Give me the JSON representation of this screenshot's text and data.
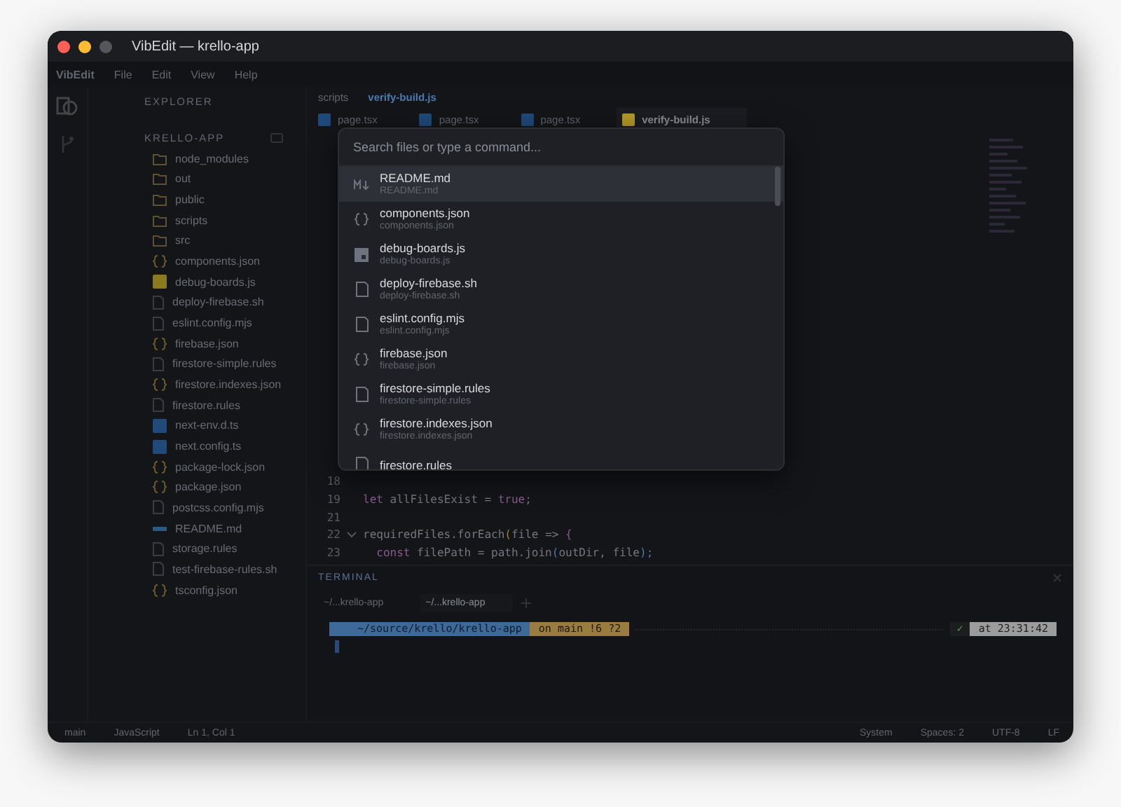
{
  "window": {
    "title": "VibEdit — krello-app"
  },
  "menu": [
    "VibEdit",
    "File",
    "Edit",
    "View",
    "Help"
  ],
  "sidebar": {
    "title": "EXPLORER",
    "project": "KRELLO-APP",
    "items": [
      {
        "label": "node_modules",
        "kind": "folder"
      },
      {
        "label": "out",
        "kind": "folder"
      },
      {
        "label": "public",
        "kind": "folder"
      },
      {
        "label": "scripts",
        "kind": "folder"
      },
      {
        "label": "src",
        "kind": "folder"
      },
      {
        "label": "components.json",
        "kind": "json"
      },
      {
        "label": "debug-boards.js",
        "kind": "js"
      },
      {
        "label": "deploy-firebase.sh",
        "kind": "file"
      },
      {
        "label": "eslint.config.mjs",
        "kind": "file"
      },
      {
        "label": "firebase.json",
        "kind": "json"
      },
      {
        "label": "firestore-simple.rules",
        "kind": "file"
      },
      {
        "label": "firestore.indexes.json",
        "kind": "json"
      },
      {
        "label": "firestore.rules",
        "kind": "file"
      },
      {
        "label": "next-env.d.ts",
        "kind": "ts"
      },
      {
        "label": "next.config.ts",
        "kind": "ts"
      },
      {
        "label": "package-lock.json",
        "kind": "json"
      },
      {
        "label": "package.json",
        "kind": "json"
      },
      {
        "label": "postcss.config.mjs",
        "kind": "file"
      },
      {
        "label": "README.md",
        "kind": "md"
      },
      {
        "label": "storage.rules",
        "kind": "file"
      },
      {
        "label": "test-firebase-rules.sh",
        "kind": "file"
      },
      {
        "label": "tsconfig.json",
        "kind": "json"
      }
    ]
  },
  "editor": {
    "breadcrumb": [
      "scripts",
      "verify-build.js"
    ],
    "tabs": [
      {
        "label": "page.tsx",
        "kind": "ts",
        "selected": false
      },
      {
        "label": "page.tsx",
        "kind": "ts",
        "selected": false
      },
      {
        "label": "page.tsx",
        "kind": "ts",
        "selected": false
      },
      {
        "label": "verify-build.js",
        "kind": "js",
        "selected": true
      }
    ],
    "lines": [
      {
        "number": "18",
        "fold": false
      },
      {
        "number": "19",
        "fold": false,
        "tokens": [
          {
            "text": "let",
            "kind": "keyword"
          },
          {
            "text": " allFilesExist = ",
            "kind": "plain"
          },
          {
            "text": "true",
            "kind": "keyword"
          },
          {
            "text": ";",
            "kind": "plain"
          }
        ]
      },
      {
        "number": "21",
        "fold": false
      },
      {
        "number": "22",
        "fold": true,
        "tokens": [
          {
            "text": "requiredFiles.forEach",
            "kind": "plain"
          },
          {
            "text": "(",
            "kind": "bracket"
          },
          {
            "text": "file => ",
            "kind": "plain"
          },
          {
            "text": "{",
            "kind": "bracket2"
          }
        ]
      },
      {
        "number": "23",
        "fold": false,
        "tokens": [
          {
            "text": "  const",
            "kind": "keyword"
          },
          {
            "text": " filePath = path.join",
            "kind": "plain"
          },
          {
            "text": "(",
            "kind": "bracket3"
          },
          {
            "text": "outDir, file",
            "kind": "plain"
          },
          {
            "text": ");",
            "kind": "bracket3"
          }
        ]
      }
    ]
  },
  "palette": {
    "placeholder": "Search files or type a command...",
    "items": [
      {
        "name": "README.md",
        "path": "README.md",
        "kind": "md",
        "selected": true
      },
      {
        "name": "components.json",
        "path": "components.json",
        "kind": "json",
        "selected": false
      },
      {
        "name": "debug-boards.js",
        "path": "debug-boards.js",
        "kind": "js",
        "selected": false
      },
      {
        "name": "deploy-firebase.sh",
        "path": "deploy-firebase.sh",
        "kind": "file",
        "selected": false
      },
      {
        "name": "eslint.config.mjs",
        "path": "eslint.config.mjs",
        "kind": "file",
        "selected": false
      },
      {
        "name": "firebase.json",
        "path": "firebase.json",
        "kind": "json",
        "selected": false
      },
      {
        "name": "firestore-simple.rules",
        "path": "firestore-simple.rules",
        "kind": "file",
        "selected": false
      },
      {
        "name": "firestore.indexes.json",
        "path": "firestore.indexes.json",
        "kind": "json",
        "selected": false
      },
      {
        "name": "firestore.rules",
        "kind": "file",
        "selected": false
      }
    ]
  },
  "terminal": {
    "title": "TERMINAL",
    "tabs": [
      {
        "label": "~/...krello-app",
        "selected": false
      },
      {
        "label": "~/...krello-app",
        "selected": true
      }
    ],
    "path": "~/source/krello/krello-app",
    "git": "on  main !6 ?2",
    "status": "✓",
    "time": "at 23:31:42"
  },
  "status_bar": {
    "left": [
      "main",
      "JavaScript",
      "Ln 1, Col 1"
    ],
    "right": [
      "System",
      "Spaces: 2",
      "UTF-8",
      "LF"
    ]
  }
}
